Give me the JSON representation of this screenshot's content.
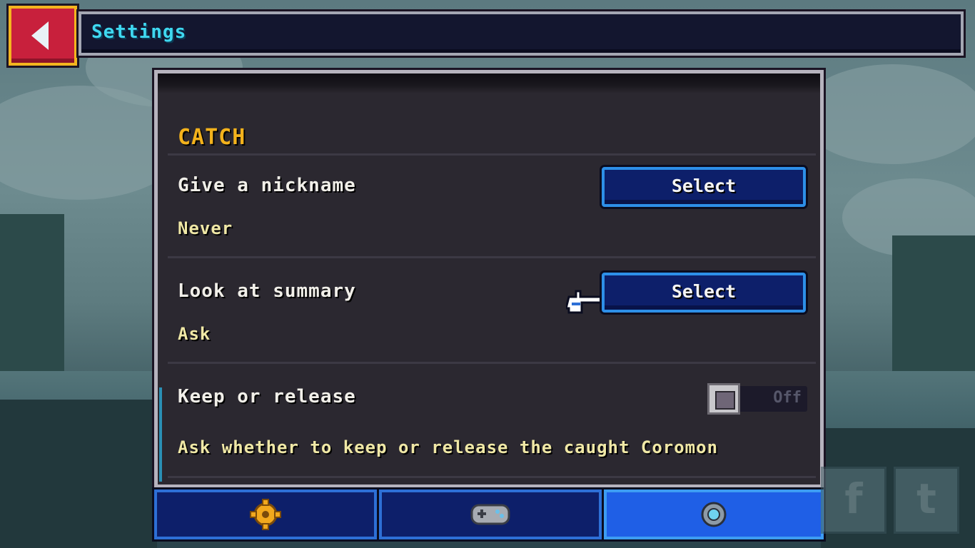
{
  "header": {
    "back_icon": "back-arrow-icon",
    "title": "Settings"
  },
  "section": {
    "title": "CATCH"
  },
  "settings": [
    {
      "label": "Give a nickname",
      "value": "Never",
      "button_label": "Select"
    },
    {
      "label": "Look at summary",
      "value": "Ask",
      "button_label": "Select"
    },
    {
      "label": "Keep or release",
      "toggle_state": "Off",
      "description": "Ask whether to keep or release the caught Coromon"
    }
  ],
  "tabs": [
    {
      "icon": "gear-icon",
      "active": false
    },
    {
      "icon": "gamepad-icon",
      "active": false
    },
    {
      "icon": "spinner-icon",
      "active": true
    }
  ],
  "social": [
    {
      "icon": "facebook-icon",
      "glyph": "f"
    },
    {
      "icon": "twitter-icon",
      "glyph": "t"
    }
  ],
  "colors": {
    "section_title": "#f3b21c",
    "title_text": "#3fd8f0",
    "button_bg": "#0d1f6a",
    "button_border": "#2d8fe8",
    "active_tab": "#1f5fe6"
  }
}
